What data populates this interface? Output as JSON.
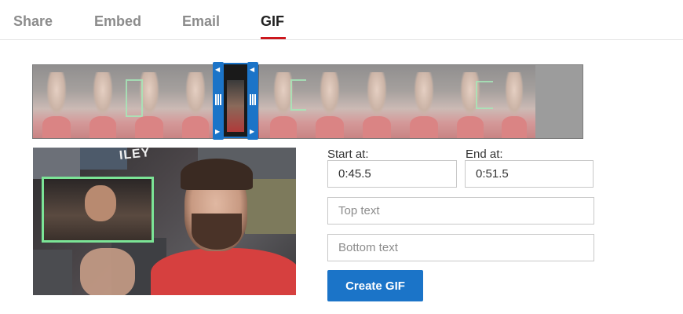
{
  "tabs": [
    {
      "label": "Share",
      "active": false
    },
    {
      "label": "Embed",
      "active": false
    },
    {
      "label": "Email",
      "active": false
    },
    {
      "label": "GIF",
      "active": true
    }
  ],
  "colors": {
    "accent_blue": "#1b74c8",
    "tab_underline_red": "#cc181e",
    "highlight_green": "#7be496"
  },
  "gif_form": {
    "start_label": "Start at:",
    "start_value": "0:45.5",
    "end_label": "End at:",
    "end_value": "0:51.5",
    "top_text_placeholder": "Top text",
    "bottom_text_placeholder": "Bottom text",
    "create_button_label": "Create GIF"
  },
  "preview": {
    "poster_text": "ILEY"
  }
}
